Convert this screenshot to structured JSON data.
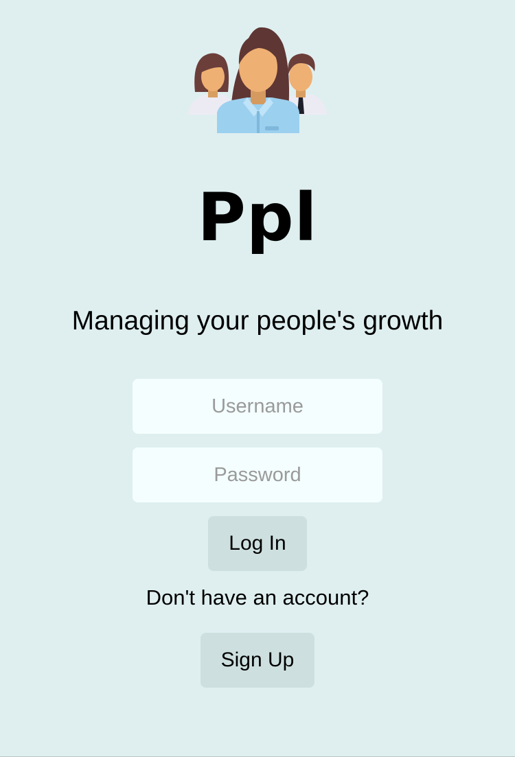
{
  "app": {
    "title": "Ppl",
    "tagline": "Managing your people's growth",
    "logo_icon": "people-group-icon"
  },
  "login_form": {
    "username_placeholder": "Username",
    "username_value": "",
    "password_placeholder": "Password",
    "password_value": "",
    "login_label": "Log In"
  },
  "signup": {
    "prompt": "Don't have an account?",
    "button_label": "Sign Up"
  },
  "colors": {
    "background": "#dfeff0",
    "input_background": "#f4fefe",
    "button_background": "#cde0df",
    "text": "#000000",
    "placeholder": "#9a9a9a"
  }
}
